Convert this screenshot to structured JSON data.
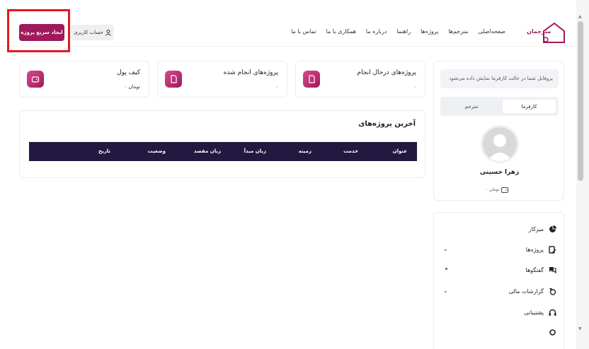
{
  "header": {
    "logo_text": "مترجمان",
    "nav": [
      "صفحه‌اصلی",
      "مترجم‌ها",
      "پروژه‌ها",
      "راهنما",
      "درباره ما",
      "همکاری با ما",
      "تماس با ما"
    ],
    "account_button": "حساب کاربری",
    "quick_project_button": "ایجاد سریع پروژه"
  },
  "stats": [
    {
      "title": "پروژه‌های درحال انجام",
      "value": "۰"
    },
    {
      "title": "پروژه‌های انجام شده",
      "value": "۰"
    },
    {
      "title": "کیف پول",
      "value": "۰ تومان"
    }
  ],
  "projects": {
    "title": "آخرین پروژه‌های",
    "columns": [
      "عنوان",
      "خدمت",
      "زمینه",
      "زبان مبدأ",
      "زبان مقصد",
      "وضعیت",
      "تاریخ"
    ]
  },
  "profile": {
    "notice": "پروفایل شما در حالت کارفرما نمایش داده می‌شود",
    "tab_employer": "کارفرما",
    "tab_translator": "مترجم",
    "name": "زهرا حسینی",
    "wallet": "۰ تومان"
  },
  "menu": {
    "dashboard": "میزکار",
    "projects": "پروژه‌ها",
    "chats": "گفتگوها",
    "financial_reports": "گزارشات مالی",
    "support": "پشتیبانی"
  },
  "colors": {
    "brand": "#a0195b",
    "table_header": "#231840",
    "highlight": "#e5191d"
  }
}
